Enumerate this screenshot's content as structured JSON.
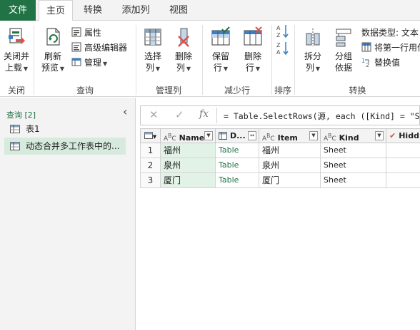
{
  "tabs": {
    "file": "文件",
    "home": "主页",
    "transform": "转换",
    "add_column": "添加列",
    "view": "视图"
  },
  "ribbon": {
    "close_load_line1": "关闭并",
    "close_load_line2": "上载",
    "close_group": "关闭",
    "refresh_line1": "刷新",
    "refresh_line2": "预览",
    "properties": "属性",
    "advanced_editor": "高级编辑器",
    "manage": "管理",
    "query_group": "查询",
    "choose_columns_line1": "选择",
    "choose_columns_line2": "列",
    "remove_columns_line1": "删除",
    "remove_columns_line2": "列",
    "manage_columns_group": "管理列",
    "keep_rows_line1": "保留",
    "keep_rows_line2": "行",
    "remove_rows_line1": "删除",
    "remove_rows_line2": "行",
    "reduce_rows_group": "减少行",
    "sort_group": "排序",
    "split_column_line1": "拆分",
    "split_column_line2": "列",
    "group_by_line1": "分组",
    "group_by_line2": "依据",
    "data_type": "数据类型: 文本",
    "use_first_row": "将第一行用作",
    "replace_values": "替换值",
    "transform_group": "转换"
  },
  "queries_pane": {
    "title": "查询 [2]",
    "items": [
      {
        "label": "表1",
        "selected": false
      },
      {
        "label": "动态合并多工作表中的...",
        "selected": true
      }
    ]
  },
  "formula_bar": {
    "formula": "= Table.SelectRows(源, each ([Kind] = \"Sh"
  },
  "grid": {
    "columns": [
      {
        "name": "Name",
        "type": "ABC"
      },
      {
        "name": "D...",
        "type": "table"
      },
      {
        "name": "Item",
        "type": "ABC"
      },
      {
        "name": "Kind",
        "type": "ABC"
      },
      {
        "name": "Hidd",
        "type": "check"
      }
    ],
    "rows": [
      {
        "num": "1",
        "name": "福州",
        "data": "Table",
        "item": "福州",
        "kind": "Sheet"
      },
      {
        "num": "2",
        "name": "泉州",
        "data": "Table",
        "item": "泉州",
        "kind": "Sheet"
      },
      {
        "num": "3",
        "name": "厦门",
        "data": "Table",
        "item": "厦门",
        "kind": "Sheet"
      }
    ]
  },
  "colors": {
    "accent": "#217346",
    "selected_column": "#e3f2e7",
    "selected_query": "#d6ebdd"
  }
}
